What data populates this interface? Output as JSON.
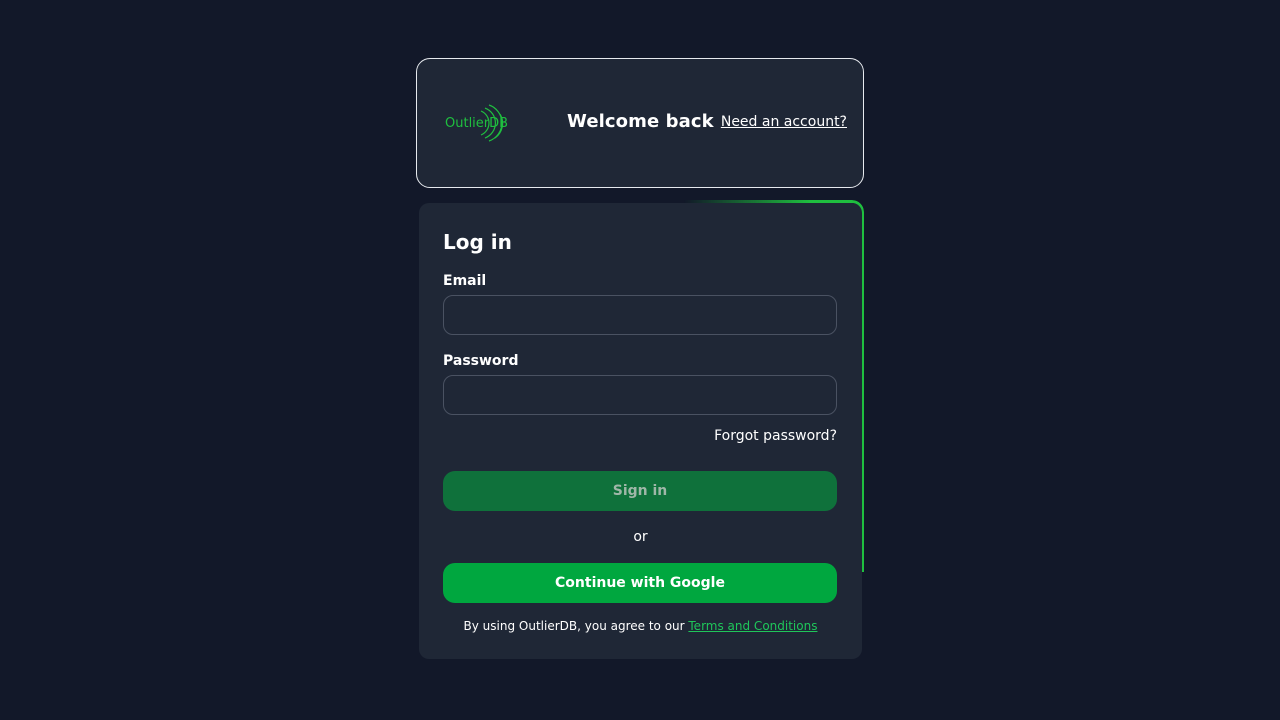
{
  "header": {
    "logo_text": "OutlierDB",
    "title": "Welcome back",
    "need_account_link": "Need an account?"
  },
  "login": {
    "title": "Log in",
    "email_label": "Email",
    "email_value": "",
    "password_label": "Password",
    "password_value": "",
    "forgot_password": "Forgot password?",
    "sign_in_button": "Sign in",
    "or_text": "or",
    "google_button": "Continue with Google",
    "terms_prefix": "By using OutlierDB, you agree to our ",
    "terms_link": "Terms and Conditions"
  },
  "colors": {
    "background": "#121829",
    "card": "#1f2736",
    "brand_green": "#00a73f",
    "sign_in_disabled": "#0f713b",
    "link_green": "#1fc65a"
  }
}
